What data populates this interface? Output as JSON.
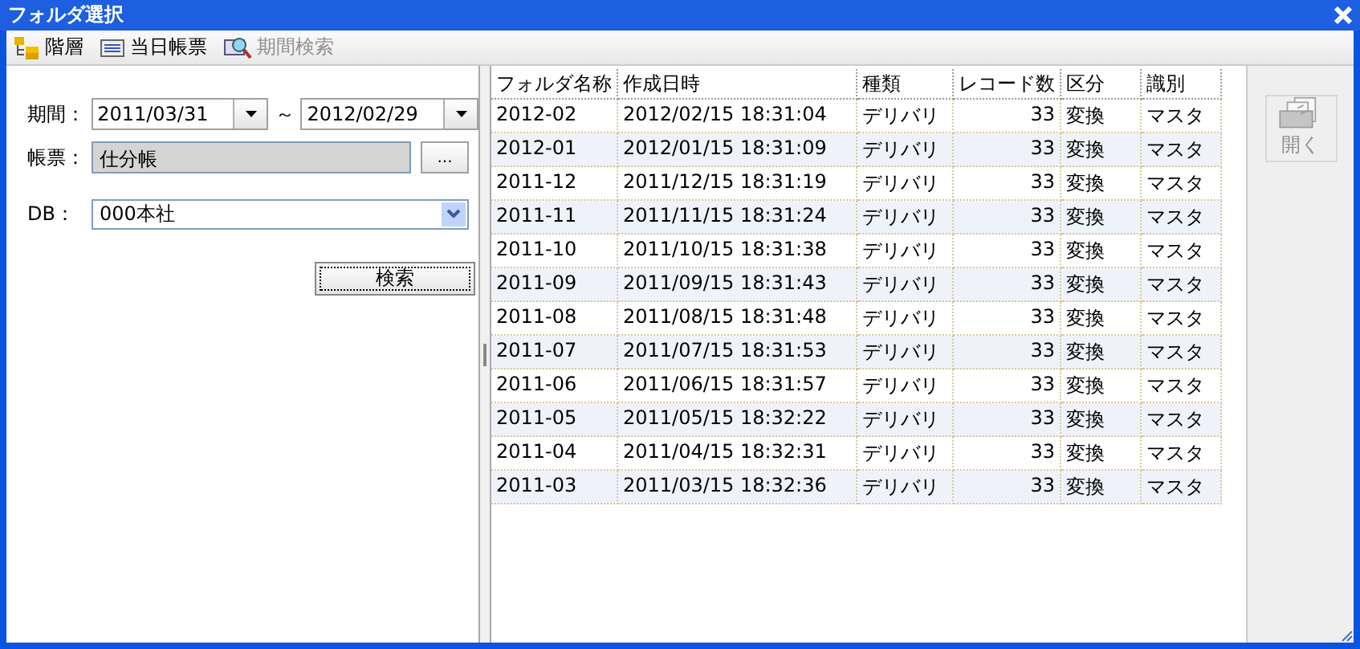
{
  "window": {
    "title": "フォルダ選択"
  },
  "toolbar": [
    {
      "kind": "tree",
      "label": "階層",
      "disabled": false
    },
    {
      "kind": "report",
      "label": "当日帳票",
      "disabled": false
    },
    {
      "kind": "search",
      "label": "期間検索",
      "disabled": true
    }
  ],
  "form": {
    "period_label": "期間：",
    "date_from": "2011/03/31",
    "range_sep": "～",
    "date_to": "2012/02/29",
    "report_label": "帳票：",
    "report_value": "仕分帳",
    "browse_button": "...",
    "db_label": "DB：",
    "db_value": "000本社",
    "search_button": "検索"
  },
  "table": {
    "columns": [
      "フォルダ名称",
      "作成日時",
      "種類",
      "レコード数",
      "区分",
      "識別"
    ],
    "rows": [
      [
        "2012-02",
        "2012/02/15 18:31:04",
        "デリバリ",
        "33",
        "変換",
        "マスタ"
      ],
      [
        "2012-01",
        "2012/01/15 18:31:09",
        "デリバリ",
        "33",
        "変換",
        "マスタ"
      ],
      [
        "2011-12",
        "2011/12/15 18:31:19",
        "デリバリ",
        "33",
        "変換",
        "マスタ"
      ],
      [
        "2011-11",
        "2011/11/15 18:31:24",
        "デリバリ",
        "33",
        "変換",
        "マスタ"
      ],
      [
        "2011-10",
        "2011/10/15 18:31:38",
        "デリバリ",
        "33",
        "変換",
        "マスタ"
      ],
      [
        "2011-09",
        "2011/09/15 18:31:43",
        "デリバリ",
        "33",
        "変換",
        "マスタ"
      ],
      [
        "2011-08",
        "2011/08/15 18:31:48",
        "デリバリ",
        "33",
        "変換",
        "マスタ"
      ],
      [
        "2011-07",
        "2011/07/15 18:31:53",
        "デリバリ",
        "33",
        "変換",
        "マスタ"
      ],
      [
        "2011-06",
        "2011/06/15 18:31:57",
        "デリバリ",
        "33",
        "変換",
        "マスタ"
      ],
      [
        "2011-05",
        "2011/05/15 18:32:22",
        "デリバリ",
        "33",
        "変換",
        "マスタ"
      ],
      [
        "2011-04",
        "2011/04/15 18:32:31",
        "デリバリ",
        "33",
        "変換",
        "マスタ"
      ],
      [
        "2011-03",
        "2011/03/15 18:32:36",
        "デリバリ",
        "33",
        "変換",
        "マスタ"
      ]
    ]
  },
  "side": {
    "open_button": {
      "label": "開く",
      "disabled": true
    }
  }
}
